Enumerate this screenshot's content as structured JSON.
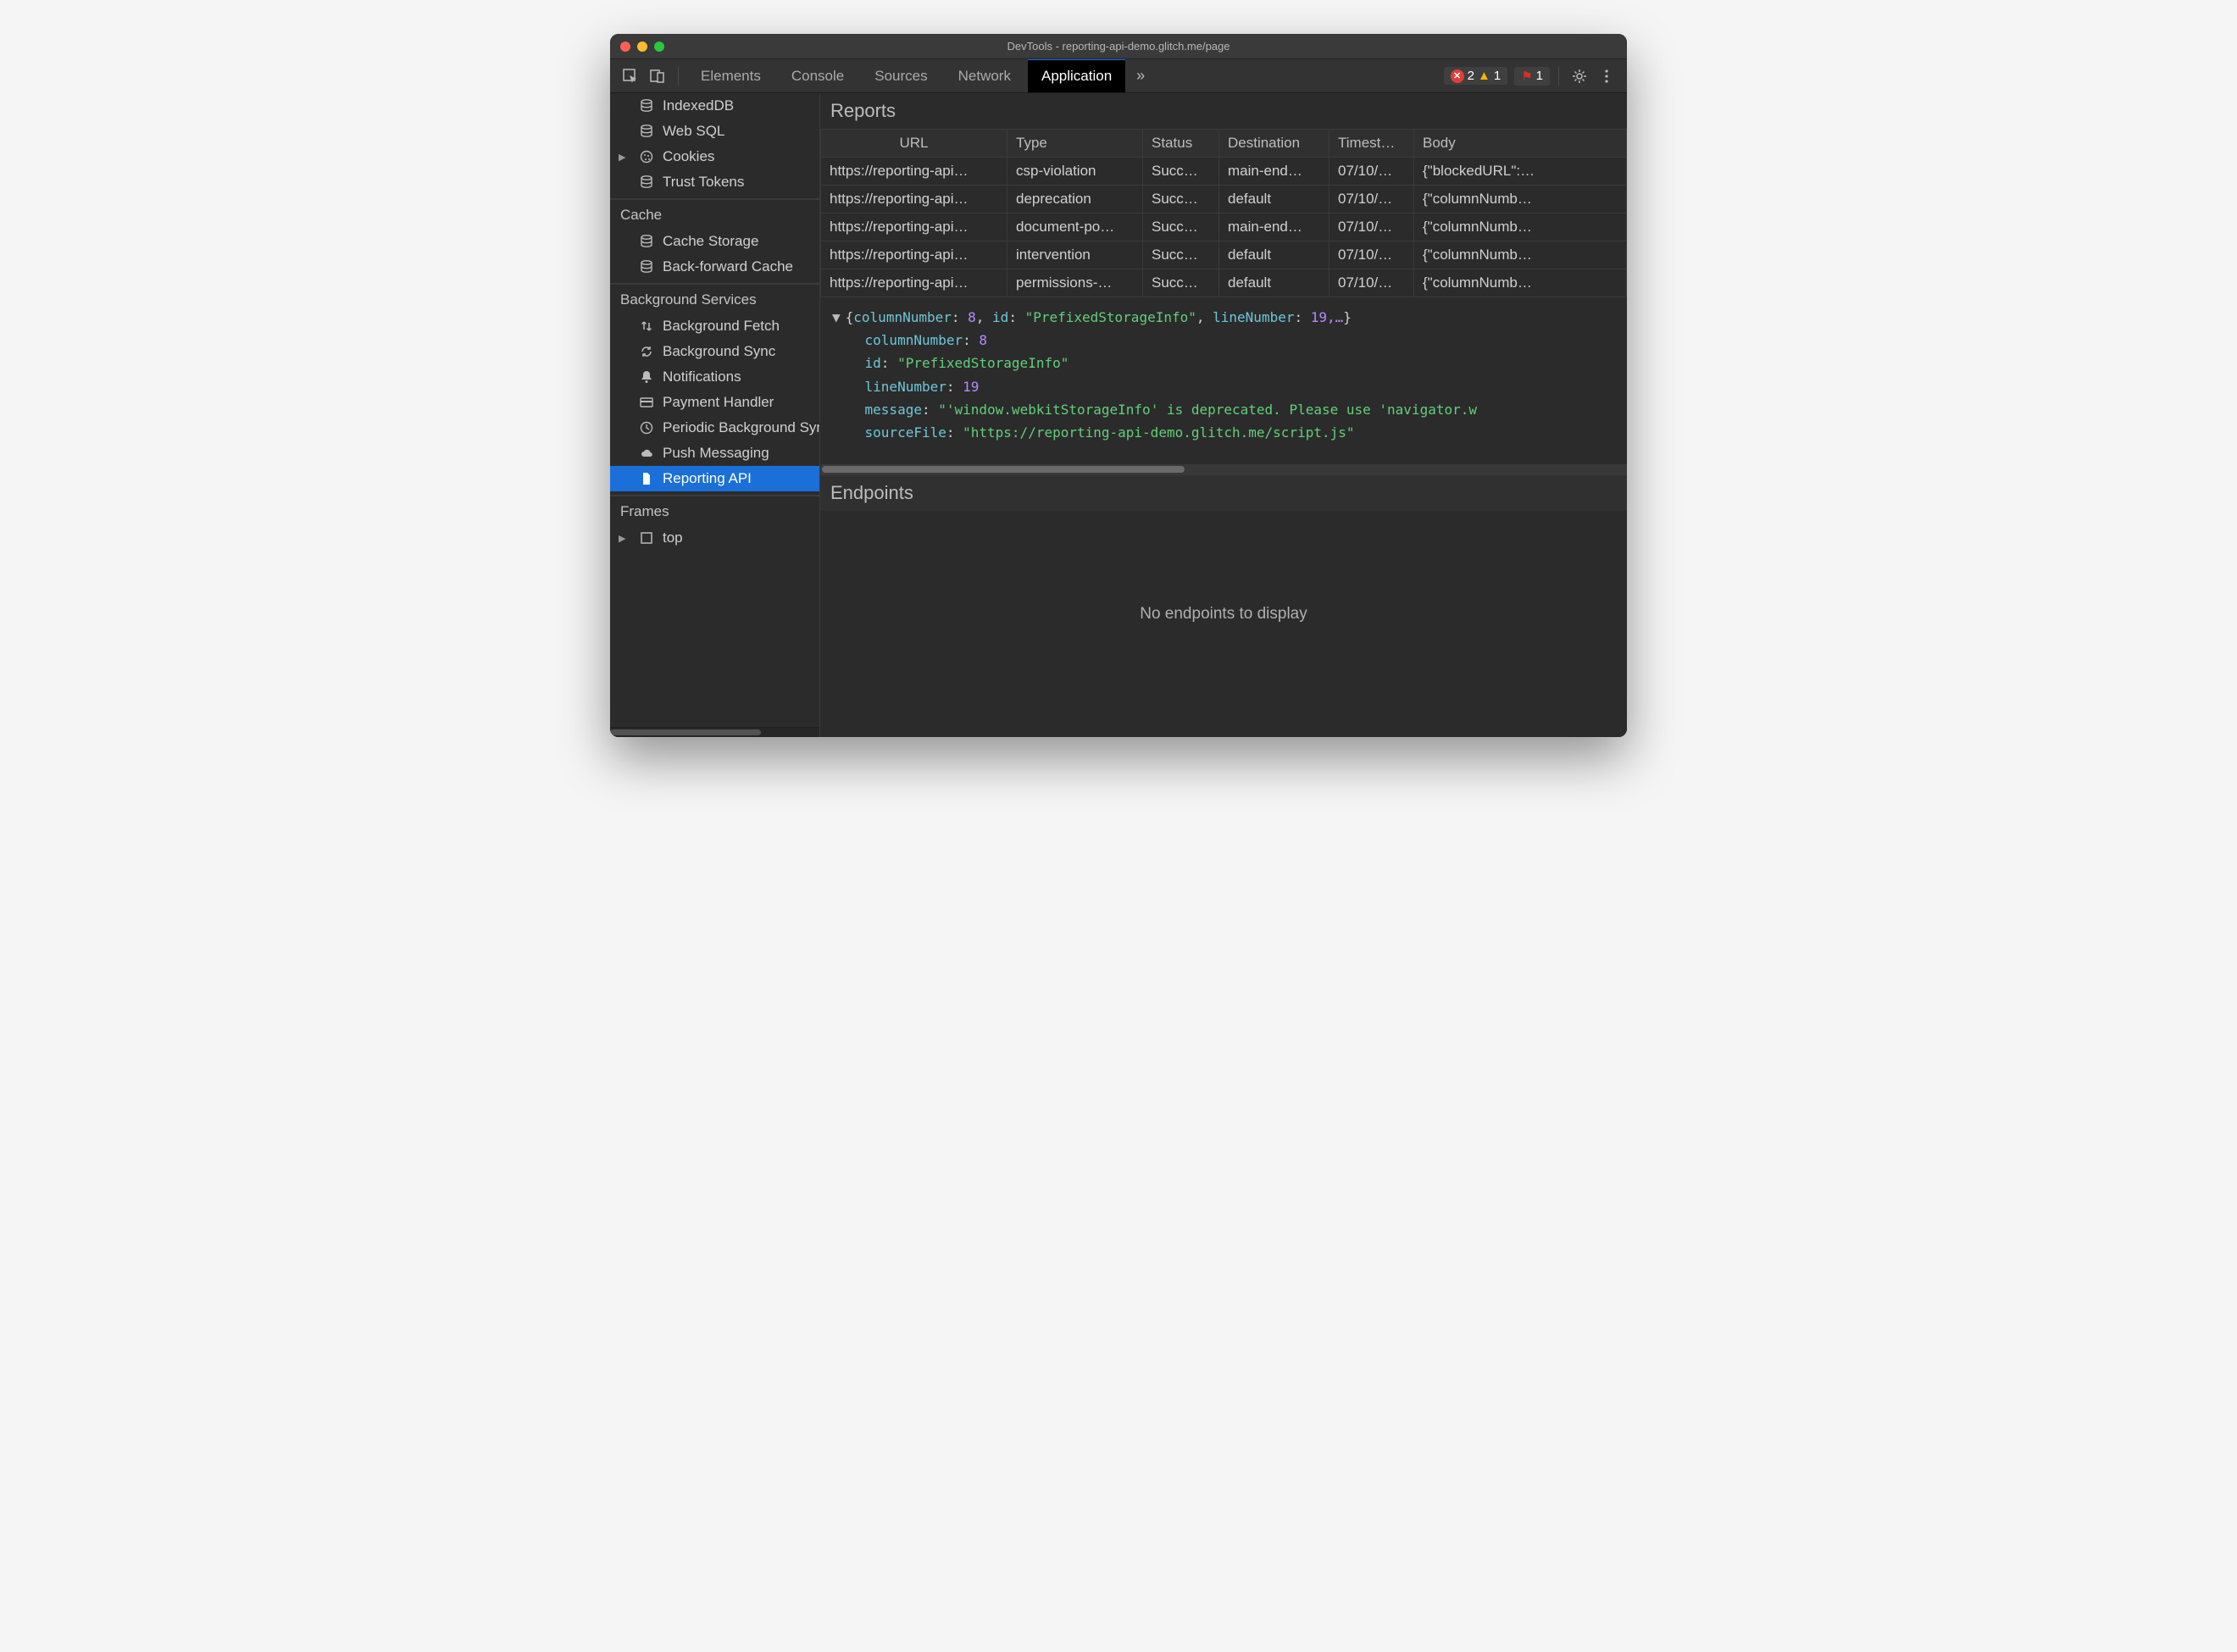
{
  "window_title": "DevTools - reporting-api-demo.glitch.me/page",
  "tabs": {
    "elements": "Elements",
    "console": "Console",
    "sources": "Sources",
    "network": "Network",
    "application": "Application"
  },
  "badges": {
    "errors": "2",
    "warnings": "1",
    "issues": "1"
  },
  "sidebar": {
    "storage_items": [
      {
        "icon": "db",
        "label": "IndexedDB"
      },
      {
        "icon": "db",
        "label": "Web SQL"
      },
      {
        "icon": "cookie",
        "label": "Cookies",
        "expandable": true
      },
      {
        "icon": "db",
        "label": "Trust Tokens"
      }
    ],
    "cache_header": "Cache",
    "cache_items": [
      {
        "icon": "db",
        "label": "Cache Storage"
      },
      {
        "icon": "db",
        "label": "Back-forward Cache"
      }
    ],
    "bg_header": "Background Services",
    "bg_items": [
      {
        "icon": "updown",
        "label": "Background Fetch"
      },
      {
        "icon": "sync",
        "label": "Background Sync"
      },
      {
        "icon": "bell",
        "label": "Notifications"
      },
      {
        "icon": "card",
        "label": "Payment Handler"
      },
      {
        "icon": "clock",
        "label": "Periodic Background Sync"
      },
      {
        "icon": "cloud",
        "label": "Push Messaging"
      },
      {
        "icon": "file",
        "label": "Reporting API",
        "selected": true
      }
    ],
    "frames_header": "Frames",
    "frames_items": [
      {
        "icon": "frame",
        "label": "top",
        "expandable": true
      }
    ]
  },
  "reports": {
    "title": "Reports",
    "columns": [
      "URL",
      "Type",
      "Status",
      "Destination",
      "Timest…",
      "Body"
    ],
    "rows": [
      {
        "url": "https://reporting-api…",
        "type": "csp-violation",
        "status": "Succ…",
        "dest": "main-end…",
        "ts": "07/10/…",
        "body": "{\"blockedURL\":…"
      },
      {
        "url": "https://reporting-api…",
        "type": "deprecation",
        "status": "Succ…",
        "dest": "default",
        "ts": "07/10/…",
        "body": "{\"columnNumb…"
      },
      {
        "url": "https://reporting-api…",
        "type": "document-po…",
        "status": "Succ…",
        "dest": "main-end…",
        "ts": "07/10/…",
        "body": "{\"columnNumb…"
      },
      {
        "url": "https://reporting-api…",
        "type": "intervention",
        "status": "Succ…",
        "dest": "default",
        "ts": "07/10/…",
        "body": "{\"columnNumb…"
      },
      {
        "url": "https://reporting-api…",
        "type": "permissions-…",
        "status": "Succ…",
        "dest": "default",
        "ts": "07/10/…",
        "body": "{\"columnNumb…"
      }
    ]
  },
  "detail": {
    "summary_colnum": "8",
    "summary_id": "\"PrefixedStorageInfo\"",
    "summary_linenum": "19,…",
    "columnNumber": "8",
    "id": "\"PrefixedStorageInfo\"",
    "lineNumber": "19",
    "message": "\"'window.webkitStorageInfo' is deprecated. Please use 'navigator.w",
    "sourceFile": "\"https://reporting-api-demo.glitch.me/script.js\""
  },
  "endpoints": {
    "title": "Endpoints",
    "empty": "No endpoints to display"
  }
}
